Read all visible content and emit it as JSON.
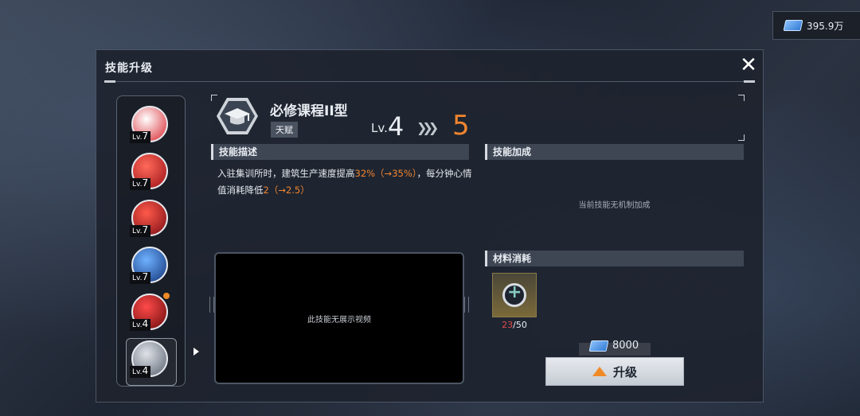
{
  "currency": {
    "icon": "ticket-icon",
    "amount": "395.9万"
  },
  "panel": {
    "title": "技能升级",
    "close_icon": "close-icon"
  },
  "skill_list": [
    {
      "level_prefix": "Lv.",
      "level": "7",
      "icon": "drone-skill-icon",
      "colors": [
        "#ffffff",
        "#d8262e"
      ]
    },
    {
      "level_prefix": "Lv.",
      "level": "7",
      "icon": "beam-skill-icon",
      "colors": [
        "#ff6a5a",
        "#9b1016"
      ]
    },
    {
      "level_prefix": "Lv.",
      "level": "7",
      "icon": "slash-skill-icon",
      "colors": [
        "#ff5a4a",
        "#7a0c14"
      ]
    },
    {
      "level_prefix": "Lv.",
      "level": "7",
      "icon": "emblem-skill-icon",
      "colors": [
        "#6fb1ff",
        "#12347a"
      ]
    },
    {
      "level_prefix": "Lv.",
      "level": "4",
      "icon": "swirl-skill-icon",
      "colors": [
        "#ff4a4a",
        "#6a0a0a"
      ],
      "notify": true
    },
    {
      "level_prefix": "Lv.",
      "level": "4",
      "icon": "graduation-cap-icon",
      "colors": [
        "#dfe3e8",
        "#5a6270"
      ],
      "selected": true
    }
  ],
  "skill": {
    "name": "必修课程II型",
    "tag": "天赋",
    "level_prefix": "Lv.",
    "level_from": "4",
    "level_to": "5",
    "icon": "graduation-cap-icon"
  },
  "description": {
    "header": "技能描述",
    "text_a": "入驻集训所时，建筑生产速度提高",
    "value_a": "32%（→35%）",
    "text_b": "，每分钟心情值消耗降低",
    "value_b": "2（→2.5）"
  },
  "bonus": {
    "header": "技能加成",
    "empty_text": "当前技能无机制加成"
  },
  "video": {
    "empty_text": "此技能无展示视频"
  },
  "materials": {
    "header": "材料消耗",
    "item_icon": "chip-material-icon",
    "owned": "23",
    "required": "/50"
  },
  "cost": {
    "icon": "ticket-icon",
    "amount": "8000"
  },
  "upgrade_button": {
    "label": "升级",
    "icon": "upgrade-arrow-icon",
    "accent": "#f08a25"
  }
}
